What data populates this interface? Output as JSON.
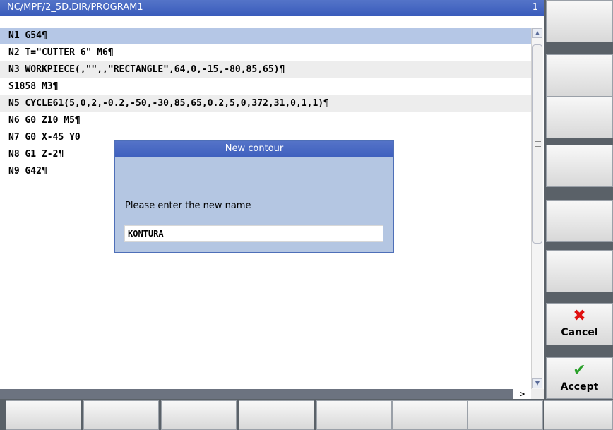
{
  "title_bar": {
    "path": "NC/MPF/2_5D.DIR/PROGRAM1",
    "line_indicator": "1"
  },
  "program_lines": [
    "N1 G54¶",
    "N2 T=\"CUTTER 6\" M6¶",
    "N3 WORKPIECE(,\"\",,\"RECTANGLE\",64,0,-15,-80,85,65)¶",
    "S1858 M3¶",
    "N5 CYCLE61(5,0,2,-0.2,-50,-30,85,65,0.2,5,0,372,31,0,1,1)¶",
    "N6 G0 Z10 M5¶",
    "N7 G0 X-45 Y0",
    "N8 G1 Z-2¶",
    "N9 G42¶"
  ],
  "scroll": {
    "right_arrow": ">"
  },
  "dialog": {
    "title": "New contour",
    "prompt": "Please enter the new name",
    "input_value": "KONTURA"
  },
  "softkeys": {
    "cancel_label": "Cancel",
    "accept_label": "Accept",
    "cancel_icon": "✖",
    "accept_icon": "✔",
    "cancel_color": "#e01010",
    "accept_color": "#2aa02a"
  }
}
